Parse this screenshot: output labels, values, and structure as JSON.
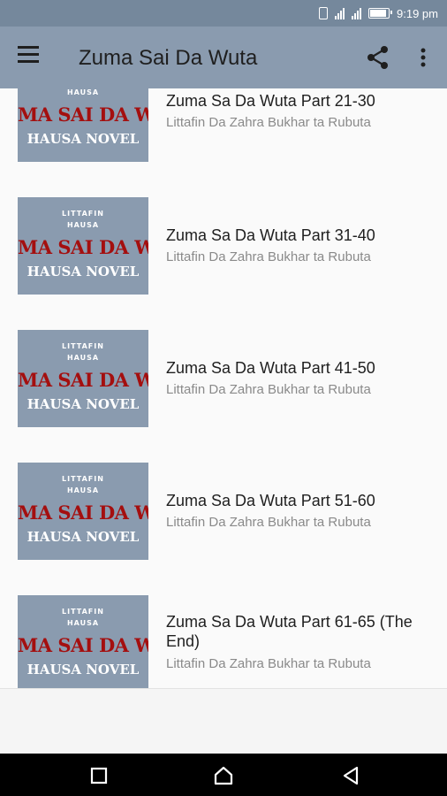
{
  "status_bar": {
    "time": "9:19 pm",
    "icons": [
      "vibrate-icon",
      "signal-icon",
      "signal-icon",
      "battery-icon"
    ]
  },
  "app_bar": {
    "title": "Zuma Sai Da Wuta",
    "icons": [
      "menu-icon",
      "share-icon",
      "more-vert-icon"
    ]
  },
  "thumbnail": {
    "line1": "LITTAFIN",
    "line2": "HAUSA",
    "big": "MA SAI DA WU",
    "novel": "HAUSA NOVEL",
    "bg_color": "#8a9baf",
    "title_color": "#a40f0f"
  },
  "items": [
    {
      "title": "Zuma Sa Da Wuta Part 21-30",
      "author": "Littafin Da Zahra Bukhar ta Rubuta"
    },
    {
      "title": "Zuma Sa Da Wuta Part 31-40",
      "author": "Littafin Da Zahra Bukhar ta Rubuta"
    },
    {
      "title": "Zuma Sa Da Wuta Part 41-50",
      "author": "Littafin Da Zahra Bukhar ta Rubuta"
    },
    {
      "title": "Zuma Sa Da Wuta Part 51-60",
      "author": "Littafin Da Zahra Bukhar ta Rubuta"
    },
    {
      "title": "Zuma Sa Da Wuta Part 61-65 (The End)",
      "author": "Littafin Da Zahra Bukhar ta Rubuta"
    }
  ],
  "nav_bar": {
    "icons": [
      "recents-icon",
      "home-icon",
      "back-icon"
    ]
  },
  "colors": {
    "status_bar": "#75889c",
    "app_bar": "#8a9baf",
    "list_bg": "#fafafa"
  }
}
